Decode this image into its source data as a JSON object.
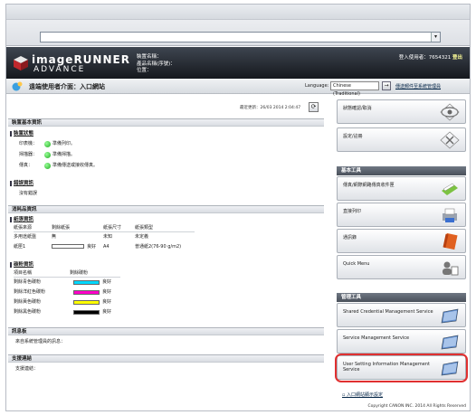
{
  "header": {
    "brand_line1": "imageRUNNER",
    "brand_line2": "ADVANCE",
    "device_name_label": "裝置名稱：",
    "product_name_label": "產品名稱(序號)：",
    "location_label": "位置：",
    "login_user": "登入使用者：7654321",
    "logout": "登出"
  },
  "subbar": {
    "title": "遠端使用者介面：入口網站",
    "language_label": "Language:",
    "language_value": "Chinese (Traditional)",
    "mail_link": "傳送郵件至系統管理員"
  },
  "status": {
    "last_updated": "最近更新：26/03 2014 2:04:47"
  },
  "device_basic": {
    "section": "裝置基本資訊",
    "device_status_title": "裝置狀態",
    "rows": [
      {
        "label": "印表機：",
        "value": "準備列印。"
      },
      {
        "label": "掃描器：",
        "value": "準備掃描。"
      },
      {
        "label": "傳真：",
        "value": "準備傳送或接收傳真。"
      }
    ],
    "error_title": "錯誤資訊",
    "error_value": "沒有錯誤"
  },
  "consumables": {
    "section": "消耗品資訊",
    "paper_title": "紙張資訊",
    "paper_headers": [
      "紙張來源",
      "剩餘紙張",
      "紙張尺寸",
      "紙張類型"
    ],
    "paper_rows": [
      [
        "多用途紙盤",
        "無",
        "未知",
        "未定義"
      ],
      [
        "紙匣1",
        "良好",
        "A4",
        "普通紙2(76-90 g/m2)"
      ]
    ],
    "toner_title": "碳粉資訊",
    "toner_headers": [
      "項目名稱",
      "剩餘碳粉"
    ],
    "toner_rows": [
      {
        "name": "剩餘青色碳粉",
        "value": "良好",
        "color": "#00d8ff"
      },
      {
        "name": "剩餘洋紅色碳粉",
        "value": "良好",
        "color": "#ff00c8"
      },
      {
        "name": "剩餘黃色碳粉",
        "value": "良好",
        "color": "#ffff00"
      },
      {
        "name": "剩餘黑色碳粉",
        "value": "良好",
        "color": "#000000"
      }
    ]
  },
  "message_board": {
    "section": "訊息板",
    "text": "來自系統管理員的訊息："
  },
  "support": {
    "section": "支援連結",
    "text": "支援連結："
  },
  "right_panel": {
    "top_items": [
      {
        "label": "狀態確認/取消"
      },
      {
        "label": "設定/註冊"
      }
    ],
    "basic_tools_header": "基本工具",
    "basic_items": [
      {
        "label": "傳真/網際網路傳真收件匣"
      },
      {
        "label": "直接列印"
      },
      {
        "label": "通訊錄"
      },
      {
        "label": "Quick Menu"
      }
    ],
    "admin_tools_header": "管理工具",
    "admin_items": [
      {
        "label": "Shared Credential Management Service"
      },
      {
        "label": "Service Management Service"
      },
      {
        "label": "User Setting Information Management Service"
      }
    ],
    "portal_link": "入口網站顯示設定",
    "copyright": "Copyright CANON INC. 2014 All Rights Reserved"
  }
}
